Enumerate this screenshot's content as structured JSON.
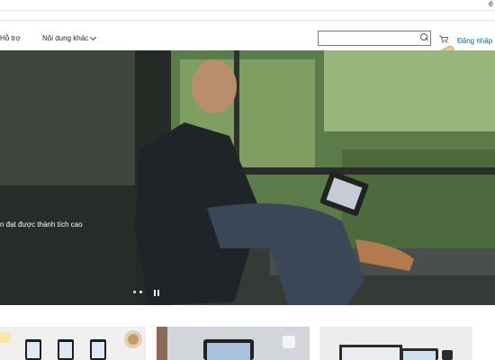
{
  "topbar": {
    "edge_char": "é"
  },
  "nav": {
    "support": "Hỗ trợ",
    "more": "Nội dung khác"
  },
  "search": {
    "placeholder": ""
  },
  "header": {
    "sign_in": "Đăng nhập"
  },
  "hero": {
    "caption": "n đạt được thành tích cao"
  },
  "colors": {
    "link": "#0067b8",
    "pointer_hand_cuff": "#0aa19a",
    "pointer_hand_skin": "#f4c38c"
  }
}
